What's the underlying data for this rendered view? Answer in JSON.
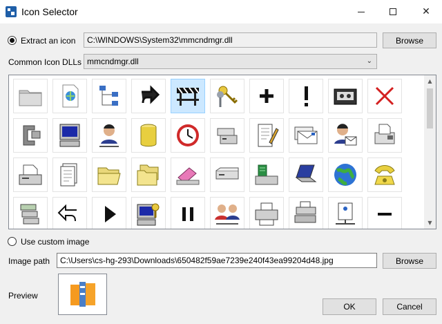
{
  "window": {
    "title": "Icon Selector"
  },
  "extract": {
    "radio_label": "Extract an icon",
    "path_value": "C:\\WINDOWS\\System32\\mmcndmgr.dll",
    "browse_label": "Browse"
  },
  "common": {
    "label": "Common Icon DLLs",
    "selected": "mmcndmgr.dll"
  },
  "grid": {
    "selected_index": 4,
    "icons": [
      "folder-icon",
      "html-document-icon",
      "network-tree-icon",
      "redo-arrow-icon",
      "roadblock-icon",
      "keys-icon",
      "plus-icon",
      "exclamation-icon",
      "tape-drive-icon",
      "red-x-icon",
      "clamp-icon",
      "computer-icon",
      "user-network-icon",
      "database-cylinder-icon",
      "clock-icon",
      "server-icon",
      "document-edit-icon",
      "envelopes-icon",
      "users-mail-icon",
      "fax-icon",
      "fax-machine-icon",
      "document-pages-icon",
      "open-folder-icon",
      "folders-icon",
      "eraser-icon",
      "drive-icon",
      "network-device-icon",
      "laptop-icon",
      "globe-icon",
      "telephone-icon",
      "server-stack-icon",
      "undo-arrow-icon",
      "play-arrow-icon",
      "secure-computer-icon",
      "pause-icon",
      "users-group-icon",
      "printer-icon",
      "printer-stack-icon",
      "network-node-icon",
      "minus-icon"
    ]
  },
  "custom": {
    "radio_label": "Use custom image",
    "image_path_label": "Image path",
    "image_path_value": "C:\\Users\\cs-hg-293\\Downloads\\650482f59ae7239e240f43ea99204d48.jpg",
    "browse_label": "Browse",
    "preview_label": "Preview"
  },
  "footer": {
    "ok_label": "OK",
    "cancel_label": "Cancel"
  }
}
